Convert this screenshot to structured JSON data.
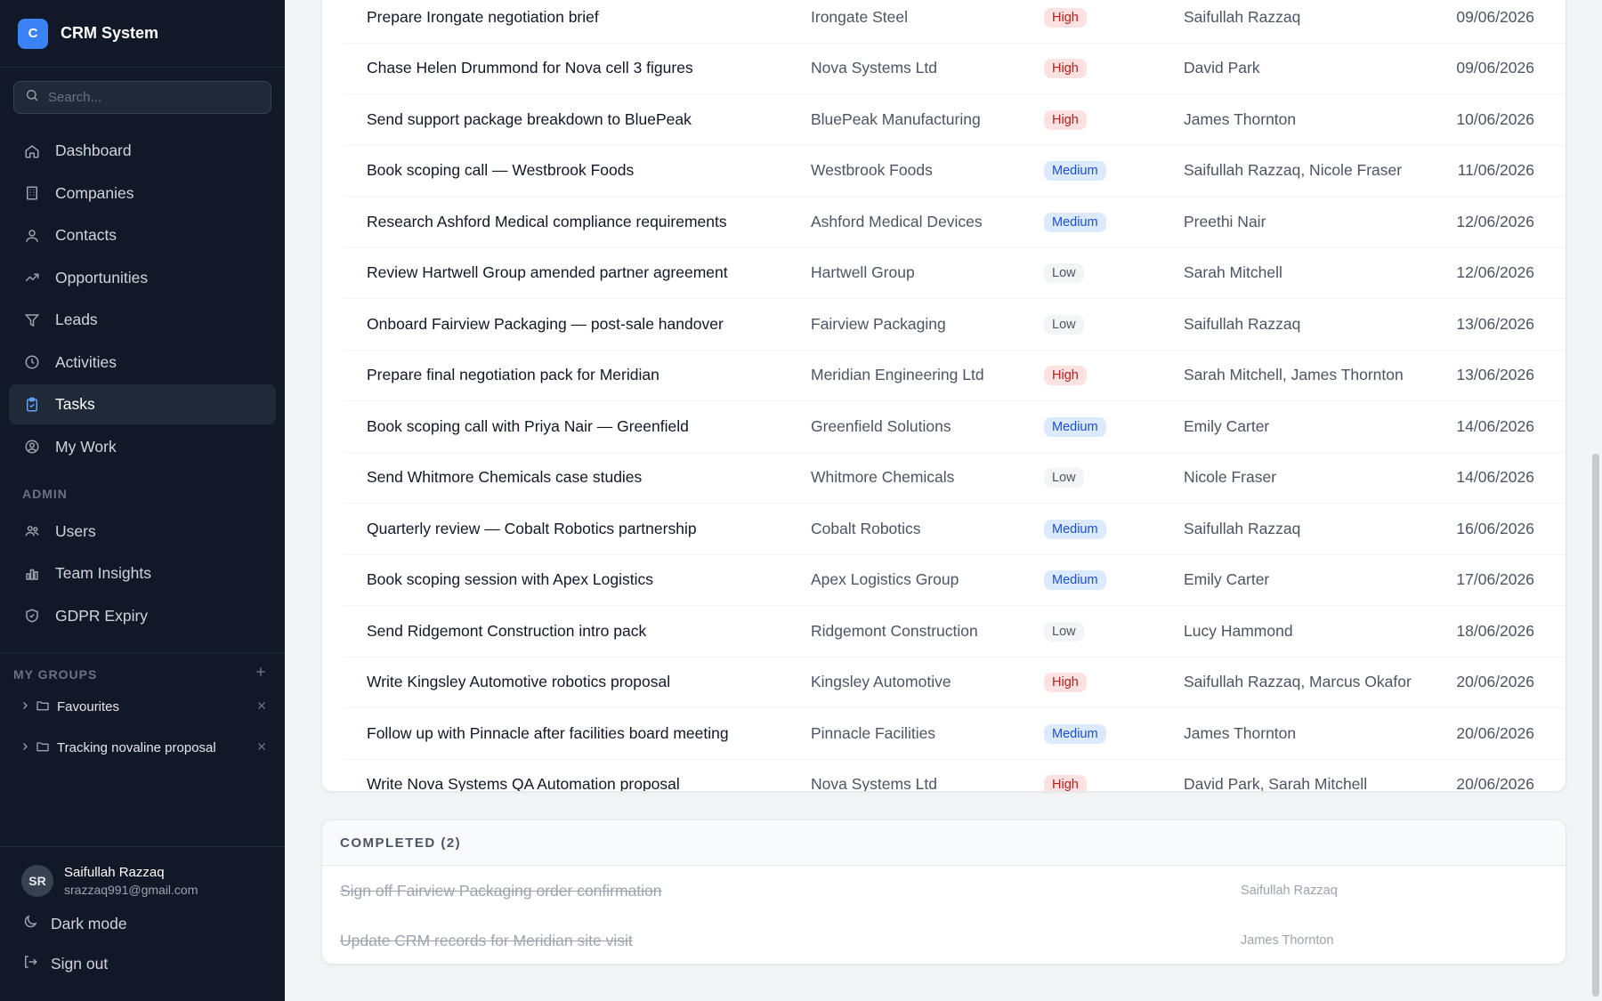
{
  "brand": {
    "logo_letter": "C",
    "name": "CRM System"
  },
  "search": {
    "placeholder": "Search..."
  },
  "nav": [
    {
      "label": "Dashboard",
      "icon": "home-icon"
    },
    {
      "label": "Companies",
      "icon": "building-icon"
    },
    {
      "label": "Contacts",
      "icon": "users-icon"
    },
    {
      "label": "Opportunities",
      "icon": "trend-icon"
    },
    {
      "label": "Leads",
      "icon": "filter-icon"
    },
    {
      "label": "Activities",
      "icon": "clock-icon"
    },
    {
      "label": "Tasks",
      "icon": "clipboard-icon",
      "active": true
    },
    {
      "label": "My Work",
      "icon": "user-circle-icon"
    }
  ],
  "admin": {
    "label": "ADMIN",
    "items": [
      {
        "label": "Users",
        "icon": "people-icon"
      },
      {
        "label": "Team Insights",
        "icon": "bar-chart-icon"
      },
      {
        "label": "GDPR Expiry",
        "icon": "shield-icon"
      }
    ]
  },
  "groups": {
    "label": "MY GROUPS",
    "items": [
      {
        "name": "Favourites"
      },
      {
        "name": "Tracking novaline proposal"
      }
    ]
  },
  "user": {
    "initials": "SR",
    "name": "Saifullah Razzaq",
    "email": "srazzaq991@gmail.com",
    "dark_mode_label": "Dark mode",
    "sign_out_label": "Sign out"
  },
  "colors": {
    "high": "#b91c1c",
    "medium": "#1d4ed8",
    "low": "#4b5563",
    "accent": "#3b82f6"
  },
  "tasks": [
    {
      "title": "Prepare Irongate negotiation brief",
      "company": "Irongate Steel",
      "priority": "High",
      "assignee": "Saifullah Razzaq",
      "due": "09/06/2026"
    },
    {
      "title": "Chase Helen Drummond for Nova cell 3 figures",
      "company": "Nova Systems Ltd",
      "priority": "High",
      "assignee": "David Park",
      "due": "09/06/2026"
    },
    {
      "title": "Send support package breakdown to BluePeak",
      "company": "BluePeak Manufacturing",
      "priority": "High",
      "assignee": "James Thornton",
      "due": "10/06/2026"
    },
    {
      "title": "Book scoping call — Westbrook Foods",
      "company": "Westbrook Foods",
      "priority": "Medium",
      "assignee": "Saifullah Razzaq, Nicole Fraser",
      "due": "11/06/2026"
    },
    {
      "title": "Research Ashford Medical compliance requirements",
      "company": "Ashford Medical Devices",
      "priority": "Medium",
      "assignee": "Preethi Nair",
      "due": "12/06/2026"
    },
    {
      "title": "Review Hartwell Group amended partner agreement",
      "company": "Hartwell Group",
      "priority": "Low",
      "assignee": "Sarah Mitchell",
      "due": "12/06/2026"
    },
    {
      "title": "Onboard Fairview Packaging — post-sale handover",
      "company": "Fairview Packaging",
      "priority": "Low",
      "assignee": "Saifullah Razzaq",
      "due": "13/06/2026"
    },
    {
      "title": "Prepare final negotiation pack for Meridian",
      "company": "Meridian Engineering Ltd",
      "priority": "High",
      "assignee": "Sarah Mitchell, James Thornton",
      "due": "13/06/2026"
    },
    {
      "title": "Book scoping call with Priya Nair — Greenfield",
      "company": "Greenfield Solutions",
      "priority": "Medium",
      "assignee": "Emily Carter",
      "due": "14/06/2026"
    },
    {
      "title": "Send Whitmore Chemicals case studies",
      "company": "Whitmore Chemicals",
      "priority": "Low",
      "assignee": "Nicole Fraser",
      "due": "14/06/2026"
    },
    {
      "title": "Quarterly review — Cobalt Robotics partnership",
      "company": "Cobalt Robotics",
      "priority": "Medium",
      "assignee": "Saifullah Razzaq",
      "due": "16/06/2026"
    },
    {
      "title": "Book scoping session with Apex Logistics",
      "company": "Apex Logistics Group",
      "priority": "Medium",
      "assignee": "Emily Carter",
      "due": "17/06/2026"
    },
    {
      "title": "Send Ridgemont Construction intro pack",
      "company": "Ridgemont Construction",
      "priority": "Low",
      "assignee": "Lucy Hammond",
      "due": "18/06/2026"
    },
    {
      "title": "Write Kingsley Automotive robotics proposal",
      "company": "Kingsley Automotive",
      "priority": "High",
      "assignee": "Saifullah Razzaq, Marcus Okafor",
      "due": "20/06/2026"
    },
    {
      "title": "Follow up with Pinnacle after facilities board meeting",
      "company": "Pinnacle Facilities",
      "priority": "Medium",
      "assignee": "James Thornton",
      "due": "20/06/2026"
    },
    {
      "title": "Write Nova Systems QA Automation proposal",
      "company": "Nova Systems Ltd",
      "priority": "High",
      "assignee": "David Park, Sarah Mitchell",
      "due": "20/06/2026"
    }
  ],
  "completed": {
    "label": "COMPLETED (2)",
    "items": [
      {
        "title": "Sign off Fairview Packaging order confirmation",
        "assignee": "Saifullah Razzaq"
      },
      {
        "title": "Update CRM records for Meridian site visit",
        "assignee": "James Thornton"
      }
    ]
  }
}
